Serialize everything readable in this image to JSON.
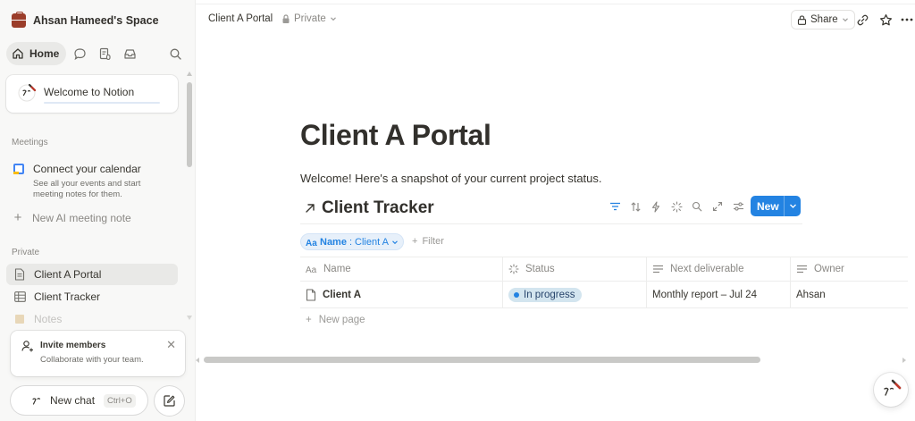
{
  "workspace": {
    "name": "Ahsan Hameed's Space"
  },
  "nav": {
    "home_label": "Home"
  },
  "welcome": {
    "label": "Welcome to Notion",
    "progress": 0
  },
  "meetings": {
    "section_label": "Meetings",
    "calendar_title": "Connect your calendar",
    "calendar_desc": "See all your events and start meeting notes for them.",
    "ai_note_label": "New AI meeting note"
  },
  "private": {
    "section_label": "Private",
    "items": [
      {
        "label": "Client A Portal",
        "icon": "page-icon",
        "active": true
      },
      {
        "label": "Client Tracker",
        "icon": "table-icon",
        "active": false
      },
      {
        "label": "Notes",
        "icon": "note-icon",
        "active": false
      }
    ]
  },
  "invite": {
    "title": "Invite members",
    "desc": "Collaborate with your team."
  },
  "chat": {
    "new_chat_label": "New chat",
    "shortcut": "Ctrl+O"
  },
  "topbar": {
    "breadcrumb": "Client A Portal",
    "privacy": "Private",
    "share_label": "Share"
  },
  "page": {
    "title": "Client A Portal",
    "intro": "Welcome! Here's a snapshot of your current project status."
  },
  "database": {
    "title": "Client Tracker",
    "new_label": "New",
    "filter_property": "Name",
    "filter_value": "Client A",
    "add_filter_label": "Filter",
    "columns": [
      "Name",
      "Status",
      "Next deliverable",
      "Owner"
    ],
    "rows": [
      {
        "name": "Client A",
        "status": "In progress",
        "next_deliverable": "Monthly report – Jul 24",
        "owner": "Ahsan"
      }
    ],
    "new_page_label": "New page"
  },
  "colors": {
    "accent": "#2383e2",
    "status_pill_bg": "#d3e5ef",
    "sidebar_bg": "#f8f8f7"
  }
}
